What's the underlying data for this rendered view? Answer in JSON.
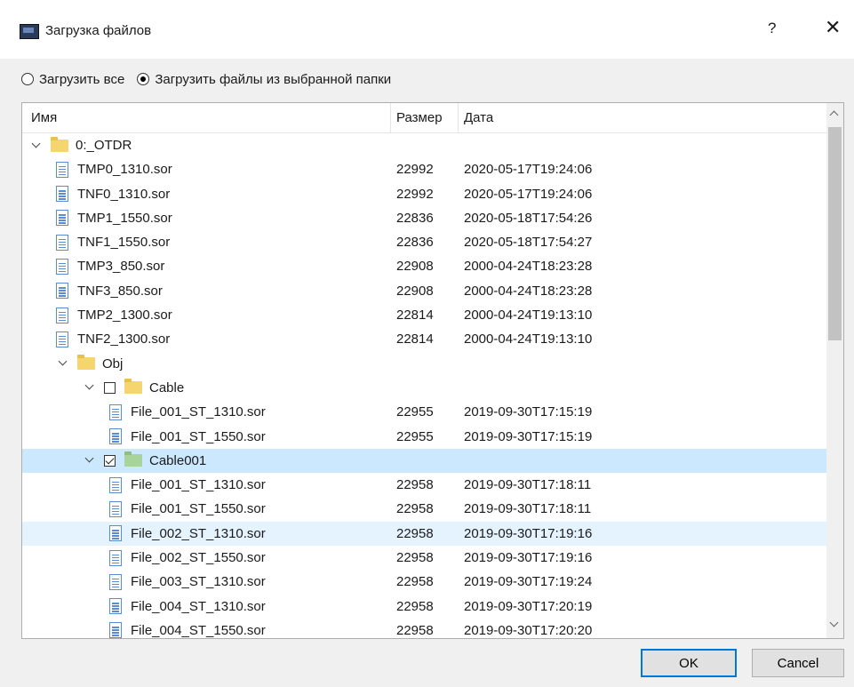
{
  "window": {
    "title": "Загрузка файлов",
    "help_label": "?",
    "close_label": "✕",
    "icon": "app-window-icon"
  },
  "options": {
    "load_all": "Загрузить все",
    "load_selected": "Загрузить файлы из выбранной папки",
    "selected_option": "load_selected"
  },
  "table": {
    "headers": {
      "name": "Имя",
      "size": "Размер",
      "date": "Дата"
    },
    "rows": [
      {
        "name": "0:_OTDR",
        "size": "",
        "date": "",
        "kind": "folder",
        "level": 0,
        "expanded": true
      },
      {
        "name": "TMP0_1310.sor",
        "size": "22992",
        "date": "2020-05-17T19:24:06",
        "kind": "file",
        "level": 1
      },
      {
        "name": "TNF0_1310.sor",
        "size": "22992",
        "date": "2020-05-17T19:24:06",
        "kind": "file",
        "level": 1
      },
      {
        "name": "TMP1_1550.sor",
        "size": "22836",
        "date": "2020-05-18T17:54:26",
        "kind": "file",
        "level": 1
      },
      {
        "name": "TNF1_1550.sor",
        "size": "22836",
        "date": "2020-05-18T17:54:27",
        "kind": "file",
        "level": 1
      },
      {
        "name": "TMP3_850.sor",
        "size": "22908",
        "date": "2000-04-24T18:23:28",
        "kind": "file",
        "level": 1
      },
      {
        "name": "TNF3_850.sor",
        "size": "22908",
        "date": "2000-04-24T18:23:28",
        "kind": "file",
        "level": 1
      },
      {
        "name": "TMP2_1300.sor",
        "size": "22814",
        "date": "2000-04-24T19:13:10",
        "kind": "file",
        "level": 1
      },
      {
        "name": "TNF2_1300.sor",
        "size": "22814",
        "date": "2000-04-24T19:13:10",
        "kind": "file",
        "level": 1
      },
      {
        "name": "Obj",
        "size": "",
        "date": "",
        "kind": "folder",
        "level": 1,
        "expanded": true
      },
      {
        "name": "Cable",
        "size": "",
        "date": "",
        "kind": "folder",
        "level": 2,
        "expanded": true,
        "checkbox": true,
        "checked": false
      },
      {
        "name": "File_001_ST_1310.sor",
        "size": "22955",
        "date": "2019-09-30T17:15:19",
        "kind": "file",
        "level": 3
      },
      {
        "name": "File_001_ST_1550.sor",
        "size": "22955",
        "date": "2019-09-30T17:15:19",
        "kind": "file",
        "level": 3
      },
      {
        "name": "Cable001",
        "size": "",
        "date": "",
        "kind": "folder",
        "level": 2,
        "expanded": true,
        "checkbox": true,
        "checked": true,
        "state": "selected",
        "folder_color": "green"
      },
      {
        "name": "File_001_ST_1310.sor",
        "size": "22958",
        "date": "2019-09-30T17:18:11",
        "kind": "file",
        "level": 3
      },
      {
        "name": "File_001_ST_1550.sor",
        "size": "22958",
        "date": "2019-09-30T17:18:11",
        "kind": "file",
        "level": 3
      },
      {
        "name": "File_002_ST_1310.sor",
        "size": "22958",
        "date": "2019-09-30T17:19:16",
        "kind": "file",
        "level": 3,
        "state": "hover"
      },
      {
        "name": "File_002_ST_1550.sor",
        "size": "22958",
        "date": "2019-09-30T17:19:16",
        "kind": "file",
        "level": 3
      },
      {
        "name": "File_003_ST_1310.sor",
        "size": "22958",
        "date": "2019-09-30T17:19:24",
        "kind": "file",
        "level": 3
      },
      {
        "name": "File_004_ST_1310.sor",
        "size": "22958",
        "date": "2019-09-30T17:20:19",
        "kind": "file",
        "level": 3
      },
      {
        "name": "File_004_ST_1550.sor",
        "size": "22958",
        "date": "2019-09-30T17:20:20",
        "kind": "file",
        "level": 3
      }
    ]
  },
  "buttons": {
    "ok": "OK",
    "cancel": "Cancel"
  },
  "colors": {
    "selected_row": "#cce8ff",
    "hover_row": "#e5f3ff",
    "accent": "#0078d7"
  }
}
